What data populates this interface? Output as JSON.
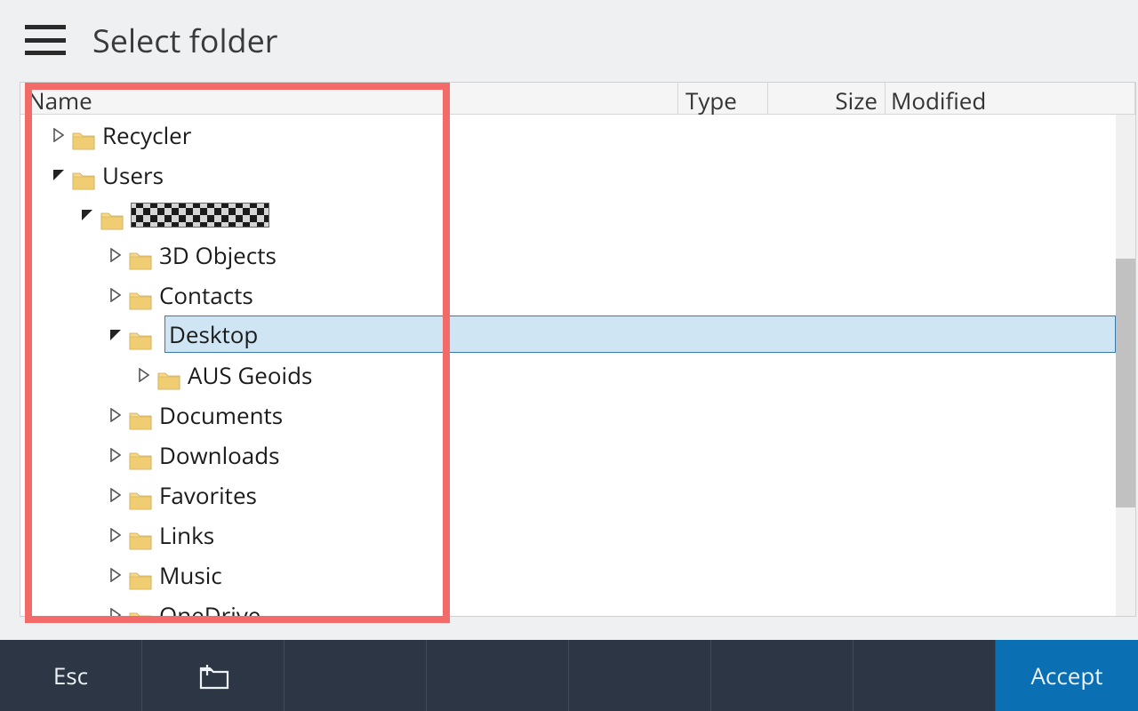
{
  "header": {
    "title": "Select folder"
  },
  "columns": {
    "name": "Name",
    "type": "Type",
    "size": "Size",
    "modified": "Modified"
  },
  "tree": [
    {
      "level": 1,
      "label": "Recycler",
      "expanded": false,
      "selected": false,
      "hasChildren": true
    },
    {
      "level": 1,
      "label": "Users",
      "expanded": true,
      "selected": false,
      "hasChildren": true
    },
    {
      "level": 2,
      "label": "████",
      "expanded": true,
      "selected": false,
      "hasChildren": true,
      "obscured": true
    },
    {
      "level": 3,
      "label": "3D Objects",
      "expanded": false,
      "selected": false,
      "hasChildren": true
    },
    {
      "level": 3,
      "label": "Contacts",
      "expanded": false,
      "selected": false,
      "hasChildren": true
    },
    {
      "level": 3,
      "label": "Desktop",
      "expanded": true,
      "selected": true,
      "hasChildren": true
    },
    {
      "level": 4,
      "label": "AUS Geoids",
      "expanded": false,
      "selected": false,
      "hasChildren": true
    },
    {
      "level": 3,
      "label": "Documents",
      "expanded": false,
      "selected": false,
      "hasChildren": true
    },
    {
      "level": 3,
      "label": "Downloads",
      "expanded": false,
      "selected": false,
      "hasChildren": true
    },
    {
      "level": 3,
      "label": "Favorites",
      "expanded": false,
      "selected": false,
      "hasChildren": true
    },
    {
      "level": 3,
      "label": "Links",
      "expanded": false,
      "selected": false,
      "hasChildren": true
    },
    {
      "level": 3,
      "label": "Music",
      "expanded": false,
      "selected": false,
      "hasChildren": true
    },
    {
      "level": 3,
      "label": "OneDrive",
      "expanded": false,
      "selected": false,
      "hasChildren": true
    }
  ],
  "footer": {
    "esc": "Esc",
    "accept": "Accept"
  }
}
